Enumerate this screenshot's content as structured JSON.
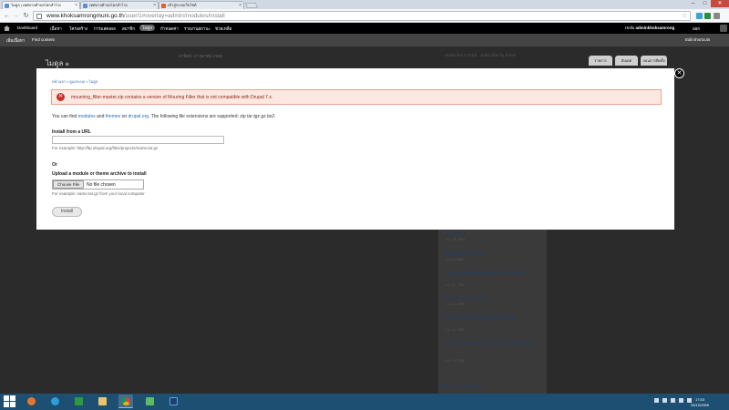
{
  "browser": {
    "tabs": [
      {
        "label": "ไมดูล | เทศบาลตำบลโคกสำโรง",
        "active": true
      },
      {
        "label": "เทศบาลตำบลโคกสำโรง",
        "active": false
      },
      {
        "label": "เข้าสู่ระบบเว็บไซต์",
        "active": false
      }
    ],
    "url_host": "www.khoksamrongmuni.go.th",
    "url_path": "/user/1#overlay=admin/modules/install",
    "window_controls": {
      "minimize": "–",
      "maximize": "□",
      "close": "✕"
    }
  },
  "admin_toolbar": {
    "items": [
      "Dashboard",
      "เนื้อหา",
      "โครงสร้าง",
      "การแสดงผล",
      "สมาชิก",
      "ไมดูล",
      "กำหนดค่า",
      "รายงานสถานะ",
      "ช่วยเหลือ"
    ],
    "active_item": "ไมดูล",
    "greeting": "Hello",
    "username": "adminkhoksamrong",
    "logout": "ออก"
  },
  "shortcuts_bar": {
    "items": [
      "เพิ่มเนื้อหา",
      "Find content"
    ],
    "edit_shortcuts": "Edit shortcuts"
  },
  "page": {
    "title": "ไมดูล",
    "date": "อาทิตย์, 27 ตุลาคม 2559",
    "subscribe_rss": "Subscribe to RSS",
    "subscribe_email": "Subscribe by Email",
    "tabs": [
      "รายการ",
      "อัปเดต",
      "ถอนการติดตั้ง"
    ]
  },
  "modal": {
    "breadcrumb": "หน้าแรก » ดูแลระบบ » ไมดูล",
    "error_message": "mourning_filter-master.zip contains a version of Mouring Filter that is not compatible with Drupal 7.x.",
    "info": {
      "prefix": "You can find",
      "link_modules": "modules",
      "and": "and",
      "link_themes": "themes",
      "on": "on",
      "link_drupal": "drupal.org",
      "suffix": ". The following file extensions are supported:",
      "extensions": "zip tar tgz gz bz2."
    },
    "install_url_label": "Install from a URL",
    "install_url_value": "",
    "install_url_desc": "For example: http://ftp.drupal.org/files/projects/name.tar.gz",
    "or_label": "Or",
    "upload_label": "Upload a module or theme archive to install",
    "choose_file": "Choose File",
    "no_file": "No file chosen",
    "upload_desc": "For example: name.tar.gz from your local computer",
    "install_button": "Install"
  },
  "sidebar_news": [
    {
      "title": "ประชุมสภา",
      "date": "ต.ค. 25, 2559"
    },
    {
      "title": "มีเตรียมโครงการใหญ่",
      "date": "ต.ค. 6, 2559"
    },
    {
      "title": "โครงการอบรมพัฒนาศักยภาพ ประจำปี 2559",
      "date": "ก.ย. 22, 2559"
    },
    {
      "title": "โครงการตามแผนงาน",
      "date": "ก.ย. 20, 2559"
    },
    {
      "title": "ประชาสัมพันธ์การรับสมัครสมาชิกชุมชน",
      "date": "ก.ย. 17, 2559"
    },
    {
      "title": "โครงการป้องกันและแก้ไขปัญหายาเสพติดในชุมชน",
      "date": "ก.ย. 12, 2559"
    }
  ],
  "sidebar_footer": "หนังสือราชการ / ดาวน์โหลด",
  "taskbar": {
    "time": "17:53",
    "date": "25/10/2559"
  }
}
